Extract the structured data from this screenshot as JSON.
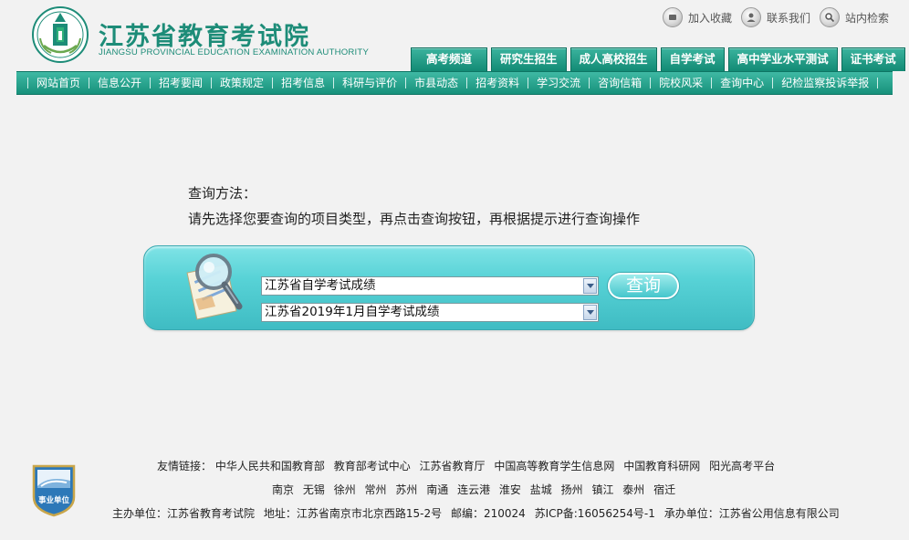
{
  "site": {
    "name_cn": "江苏省教育考试院",
    "name_en": "JIANGSU PROVINCIAL EDUCATION EXAMINATION AUTHORITY"
  },
  "top_links": [
    {
      "label": "加入收藏",
      "icon": "bookmark-icon"
    },
    {
      "label": "联系我们",
      "icon": "contact-icon"
    },
    {
      "label": "站内检索",
      "icon": "search-icon"
    }
  ],
  "channel_tabs": [
    "高考频道",
    "研究生招生",
    "成人高校招生",
    "自学考试",
    "高中学业水平测试",
    "证书考试"
  ],
  "nav_items": [
    "网站首页",
    "信息公开",
    "招考要闻",
    "政策规定",
    "招考信息",
    "科研与评价",
    "市县动态",
    "招考资料",
    "学习交流",
    "咨询信箱",
    "院校风采",
    "查询中心",
    "纪检监察投诉举报"
  ],
  "method": {
    "title": "查询方法：",
    "text": "请先选择您要查询的项目类型，再点击查询按钮，再根据提示进行查询操作"
  },
  "query": {
    "type_select": "江苏省自学考试成绩",
    "item_select": "江苏省2019年1月自学考试成绩",
    "button_label": "查询"
  },
  "footer": {
    "links_label": "友情链接：",
    "links": [
      "中华人民共和国教育部",
      "教育部考试中心",
      "江苏省教育厅",
      "中国高等教育学生信息网",
      "中国教育科研网",
      "阳光高考平台"
    ],
    "cities": [
      "南京",
      "无锡",
      "徐州",
      "常州",
      "苏州",
      "南通",
      "连云港",
      "淮安",
      "盐城",
      "扬州",
      "镇江",
      "泰州",
      "宿迁"
    ],
    "sponsor_label": "主办单位：",
    "sponsor": "江苏省教育考试院",
    "address_label": "地址：",
    "address": "江苏省南京市北京西路15-2号",
    "postcode_label": "邮编：",
    "postcode": "210024",
    "icp": "苏ICP备:16056254号-1",
    "organizer_label": "承办单位：",
    "organizer": "江苏省公用信息有限公司",
    "badge_text": "事业单位"
  },
  "colors": {
    "brand_green": "#1d8c78",
    "tab_green": "#128a74",
    "query_panel": "#57d2d6",
    "background": "#f2f2f2"
  }
}
